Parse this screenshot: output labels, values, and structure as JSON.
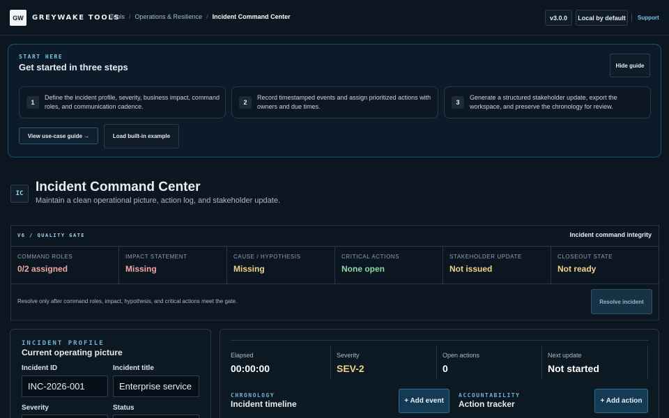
{
  "brand": {
    "logo": "GW",
    "name": "GREYWAKE TOOLS"
  },
  "breadcrumb": [
    "Tools",
    "Operations & Resilience",
    "Incident Command Center"
  ],
  "header_actions": {
    "version": "v3.0.0",
    "local": "Local by default",
    "support": "Support"
  },
  "start": {
    "eyebrow": "START HERE",
    "title": "Get started in three steps",
    "hide_label": "Hide guide",
    "steps": [
      {
        "num": "1",
        "text": "Define the incident profile, severity, business impact, command roles, and communication cadence."
      },
      {
        "num": "2",
        "text": "Record timestamped events and assign prioritized actions with owners and due times."
      },
      {
        "num": "3",
        "text": "Generate a structured stakeholder update, export the workspace, and preserve the chronology for review."
      }
    ],
    "guide_button": "View use-case guide →",
    "example_button": "Load built-in example"
  },
  "app": {
    "badge": "IC",
    "title": "Incident Command Center",
    "subtitle": "Maintain a clean operational picture, action log, and stakeholder update."
  },
  "gate": {
    "eyebrow": "V6 / QUALITY GATE",
    "label": "Incident command integrity",
    "cells": [
      {
        "label": "COMMAND ROLES",
        "value": "0/2 assigned",
        "status": "red"
      },
      {
        "label": "IMPACT STATEMENT",
        "value": "Missing",
        "status": "red"
      },
      {
        "label": "CAUSE / HYPOTHESIS",
        "value": "Missing",
        "status": "yel"
      },
      {
        "label": "CRITICAL ACTIONS",
        "value": "None open",
        "status": "grn"
      },
      {
        "label": "STAKEHOLDER UPDATE",
        "value": "Not issued",
        "status": "yel"
      },
      {
        "label": "CLOSEOUT STATE",
        "value": "Not ready",
        "status": "yel"
      }
    ],
    "note": "Resolve only after command roles, impact, hypothesis, and critical actions meet the gate.",
    "resolve_button": "Resolve incident"
  },
  "profile": {
    "eyebrow": "INCIDENT PROFILE",
    "title": "Current operating picture",
    "id_label": "Incident ID",
    "id_value": "INC-2026-001",
    "title_label": "Incident title",
    "title_value": "Enterprise service",
    "severity_label": "Severity",
    "status_label": "Status"
  },
  "metrics": [
    {
      "label": "Elapsed",
      "value": "00:00:00",
      "color": "#ffffff"
    },
    {
      "label": "Severity",
      "value": "SEV-2",
      "color": "#f0d48a"
    },
    {
      "label": "Open actions",
      "value": "0",
      "color": "#ffffff"
    },
    {
      "label": "Next update",
      "value": "Not started",
      "color": "#ffffff"
    }
  ],
  "timeline": {
    "eyebrow": "CHRONOLOGY",
    "title": "Incident timeline",
    "add_button": "+ Add event"
  },
  "tracker": {
    "eyebrow": "ACCOUNTABILITY",
    "title": "Action tracker",
    "add_button": "+ Add action"
  },
  "colors": {
    "accent": "#7cc5e8",
    "danger": "#f3a6a6",
    "warning": "#f0d48a",
    "ok": "#8fd8a8"
  }
}
